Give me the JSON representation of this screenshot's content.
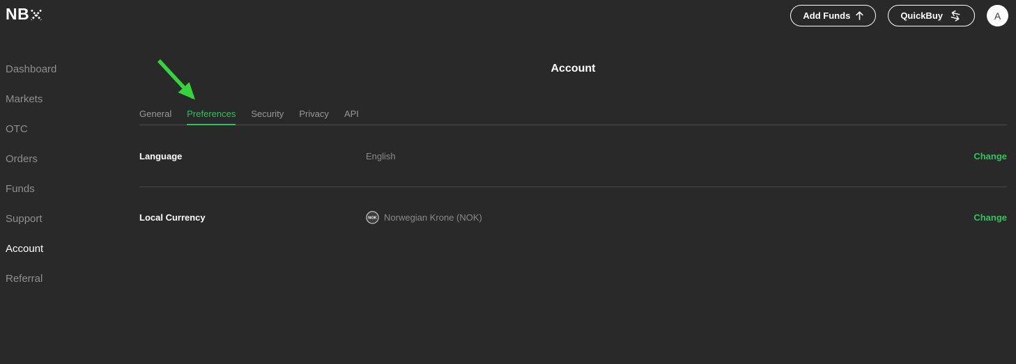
{
  "app": {
    "name": "NBX"
  },
  "header": {
    "logo": "NB",
    "add_funds_button": "Add Funds",
    "quickbuy_button": "QuickBuy",
    "avatar_initial": "A"
  },
  "sidebar": {
    "items": [
      {
        "label": "Dashboard",
        "active": false
      },
      {
        "label": "Markets",
        "active": false
      },
      {
        "label": "OTC",
        "active": false
      },
      {
        "label": "Orders",
        "active": false
      },
      {
        "label": "Funds",
        "active": false
      },
      {
        "label": "Support",
        "active": false
      },
      {
        "label": "Account",
        "active": true
      },
      {
        "label": "Referral",
        "active": false
      }
    ]
  },
  "main": {
    "title": "Account",
    "tabs": [
      {
        "label": "General",
        "active": false
      },
      {
        "label": "Preferences",
        "active": true
      },
      {
        "label": "Security",
        "active": false
      },
      {
        "label": "Privacy",
        "active": false
      },
      {
        "label": "API",
        "active": false
      }
    ],
    "settings": [
      {
        "label": "Language",
        "value": "English",
        "action": "Change"
      },
      {
        "label": "Local Currency",
        "value": "Norwegian Krone (NOK)",
        "icon_text": "NOK",
        "action": "Change"
      }
    ]
  },
  "annotation": {
    "type": "arrow",
    "points_to": "Preferences tab",
    "color": "#35d43c"
  },
  "colors": {
    "background": "#292929",
    "accent_green": "#2ec45f",
    "arrow_green": "#35d43c",
    "text_muted": "#8f8f8f",
    "divider": "#474747"
  }
}
